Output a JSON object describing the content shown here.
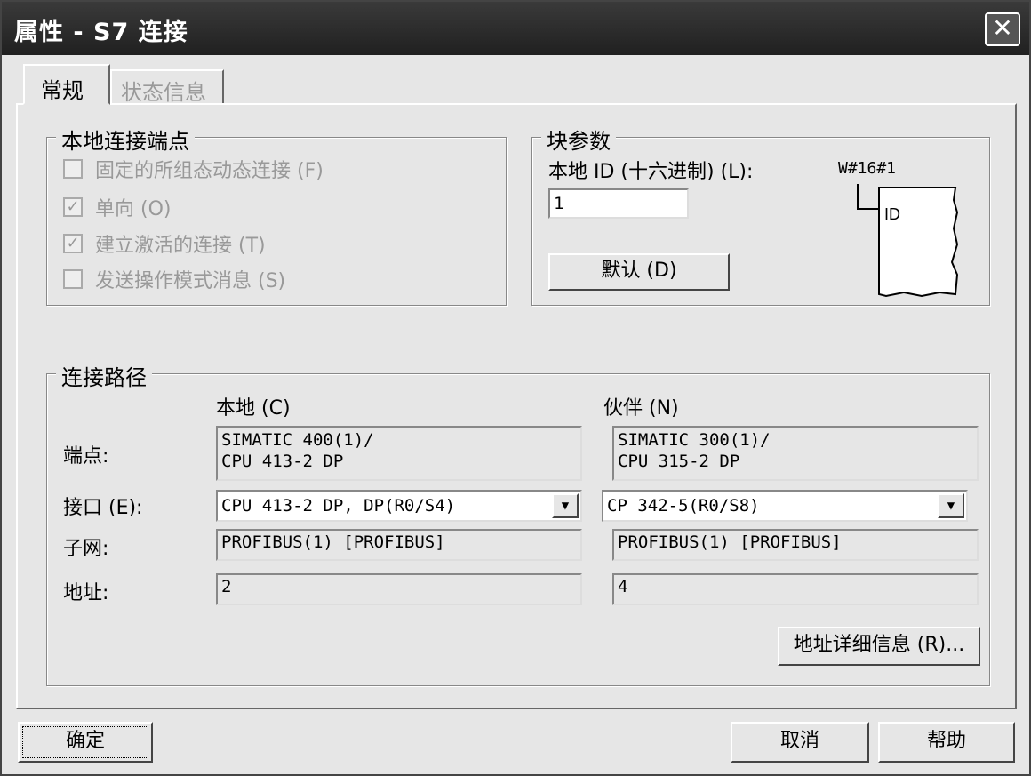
{
  "window": {
    "title": "属性 - S7 连接",
    "close_glyph": "✕"
  },
  "tabs": [
    {
      "label": "常规"
    },
    {
      "label": "状态信息"
    }
  ],
  "local_endpoint": {
    "title": "本地连接端点",
    "options": [
      {
        "label": "固定的所组态动态连接 (F)",
        "checked": false
      },
      {
        "label": "单向 (O)",
        "checked": true
      },
      {
        "label": "建立激活的连接 (T)",
        "checked": true
      },
      {
        "label": "发送操作模式消息 (S)",
        "checked": false
      }
    ]
  },
  "block_params": {
    "title": "块参数",
    "local_id_label": "本地 ID (十六进制) (L):",
    "local_id_value": "1",
    "id_display": "W#16#1",
    "diagram_label": "ID",
    "default_button": "默认 (D)"
  },
  "path": {
    "title": "连接路径",
    "local_header": "本地 (C)",
    "partner_header": "伙伴 (N)",
    "endpoint_label": "端点:",
    "interface_label": "接口 (E):",
    "subnet_label": "子网:",
    "address_label": "地址:",
    "local": {
      "endpoint_line1": "SIMATIC 400(1)/",
      "endpoint_line2": "CPU 413-2 DP",
      "interface": "CPU 413-2 DP, DP(R0/S4)",
      "subnet": "PROFIBUS(1) [PROFIBUS]",
      "address": "2"
    },
    "partner": {
      "endpoint_line1": "SIMATIC 300(1)/",
      "endpoint_line2": "CPU 315-2 DP",
      "interface": "CP 342-5(R0/S8)",
      "subnet": "PROFIBUS(1) [PROFIBUS]",
      "address": "4"
    },
    "address_details_button": "地址详细信息 (R)..."
  },
  "footer": {
    "ok": "确定",
    "cancel": "取消",
    "help": "帮助"
  },
  "icons": {
    "combo_arrow": "▼",
    "check_mark": "✓"
  }
}
